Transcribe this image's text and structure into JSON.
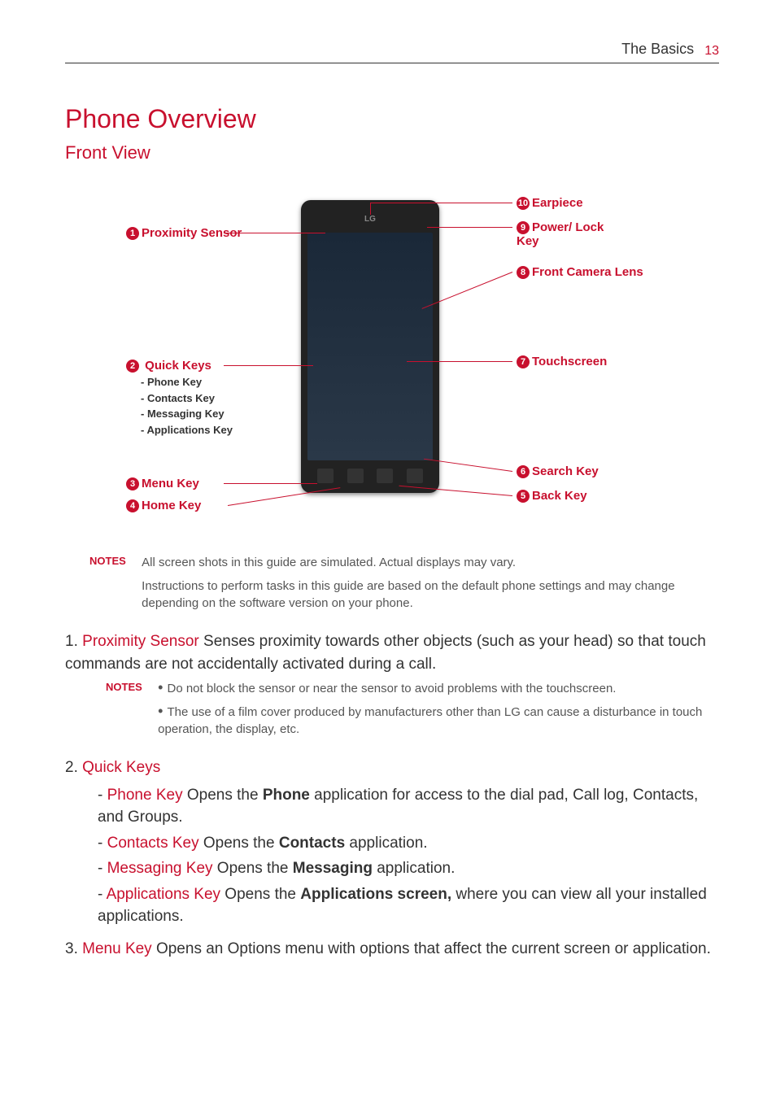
{
  "header": {
    "section": "The Basics",
    "page": "13"
  },
  "title": "Phone Overview",
  "subtitle": "Front View",
  "callouts": {
    "n1": "Proximity Sensor",
    "n2": "Quick Keys",
    "n2_subs": [
      "- Phone Key",
      "- Contacts Key",
      "- Messaging Key",
      "- Applications Key"
    ],
    "n3": "Menu Key",
    "n4": "Home Key",
    "n5": "Back Key",
    "n6": "Search Key",
    "n7": "Touchscreen",
    "n8": "Front Camera Lens",
    "n9": "Power/ Lock Key",
    "n10": "Earpiece"
  },
  "notes1": {
    "label": "NOTES",
    "p1": "All screen shots in this guide are simulated. Actual displays may vary.",
    "p2": "Instructions to perform tasks in this guide are based on the default phone settings and may change depending on the software version on your phone."
  },
  "item1": {
    "num": "1.",
    "key": "Proximity Sensor",
    "text": " Senses proximity towards other objects (such as your head) so that touch commands are not accidentally activated during a call."
  },
  "notes2": {
    "label": "NOTES",
    "b1": "Do not block the sensor or near the sensor to avoid problems with the touchscreen.",
    "b2": "The use of a film cover produced by manufacturers other than LG can cause a disturbance in touch operation, the display, etc."
  },
  "item2": {
    "num": "2.",
    "key": "Quick Keys",
    "subs": {
      "phone": {
        "key": "Phone Key",
        "text_a": " Opens the ",
        "bold": "Phone",
        "text_b": " application for access to the dial pad, Call log, Contacts, and Groups."
      },
      "contacts": {
        "key": "Contacts Key",
        "text_a": " Opens the ",
        "bold": "Contacts",
        "text_b": " application."
      },
      "msg": {
        "key": "Messaging Key",
        "text_a": " Opens the ",
        "bold": "Messaging",
        "text_b": " application."
      },
      "apps": {
        "key": "Applications Key",
        "text_a": " Opens the ",
        "bold": "Applications screen,",
        "text_b": " where you can view all your installed applications."
      }
    }
  },
  "item3": {
    "num": "3.",
    "key": "Menu Key",
    "text": " Opens an Options menu with options that affect the current screen or application."
  },
  "phone_logo": "LG"
}
